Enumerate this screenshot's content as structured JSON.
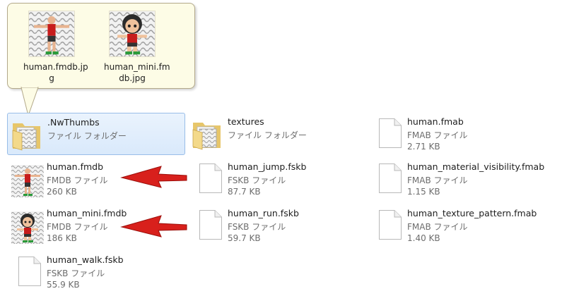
{
  "tooltip": {
    "items": [
      {
        "label": "human.fmdb.jp\ng"
      },
      {
        "label": "human_mini.fm\ndb.jpg"
      }
    ]
  },
  "files": [
    {
      "name": ".NwThumbs",
      "type": "ファイル フォルダー",
      "size": "",
      "icon": "folder-icon",
      "selected": true
    },
    {
      "name": "textures",
      "type": "ファイル フォルダー",
      "size": "",
      "icon": "folder-icon"
    },
    {
      "name": "human.fmab",
      "type": "FMAB ファイル",
      "size": "2.71 KB",
      "icon": "document-icon"
    },
    {
      "name": "human.fmdb",
      "type": "FMDB ファイル",
      "size": "260 KB",
      "icon": "human-thumbnail-icon"
    },
    {
      "name": "human_jump.fskb",
      "type": "FSKB ファイル",
      "size": "87.7 KB",
      "icon": "document-icon"
    },
    {
      "name": "human_material_visibility.fmab",
      "type": "FMAB ファイル",
      "size": "1.15 KB",
      "icon": "document-icon"
    },
    {
      "name": "human_mini.fmdb",
      "type": "FMDB ファイル",
      "size": "186 KB",
      "icon": "human-mini-thumbnail-icon"
    },
    {
      "name": "human_run.fskb",
      "type": "FSKB ファイル",
      "size": "59.7 KB",
      "icon": "document-icon"
    },
    {
      "name": "human_texture_pattern.fmab",
      "type": "FMAB ファイル",
      "size": "1.40 KB",
      "icon": "document-icon"
    },
    {
      "name": "human_walk.fskb",
      "type": "FSKB ファイル",
      "size": "55.9 KB",
      "icon": "document-icon"
    }
  ],
  "colors": {
    "arrow": "#d8201c",
    "selection": "#cce0f8",
    "tooltip_bg": "#fdfce6"
  }
}
